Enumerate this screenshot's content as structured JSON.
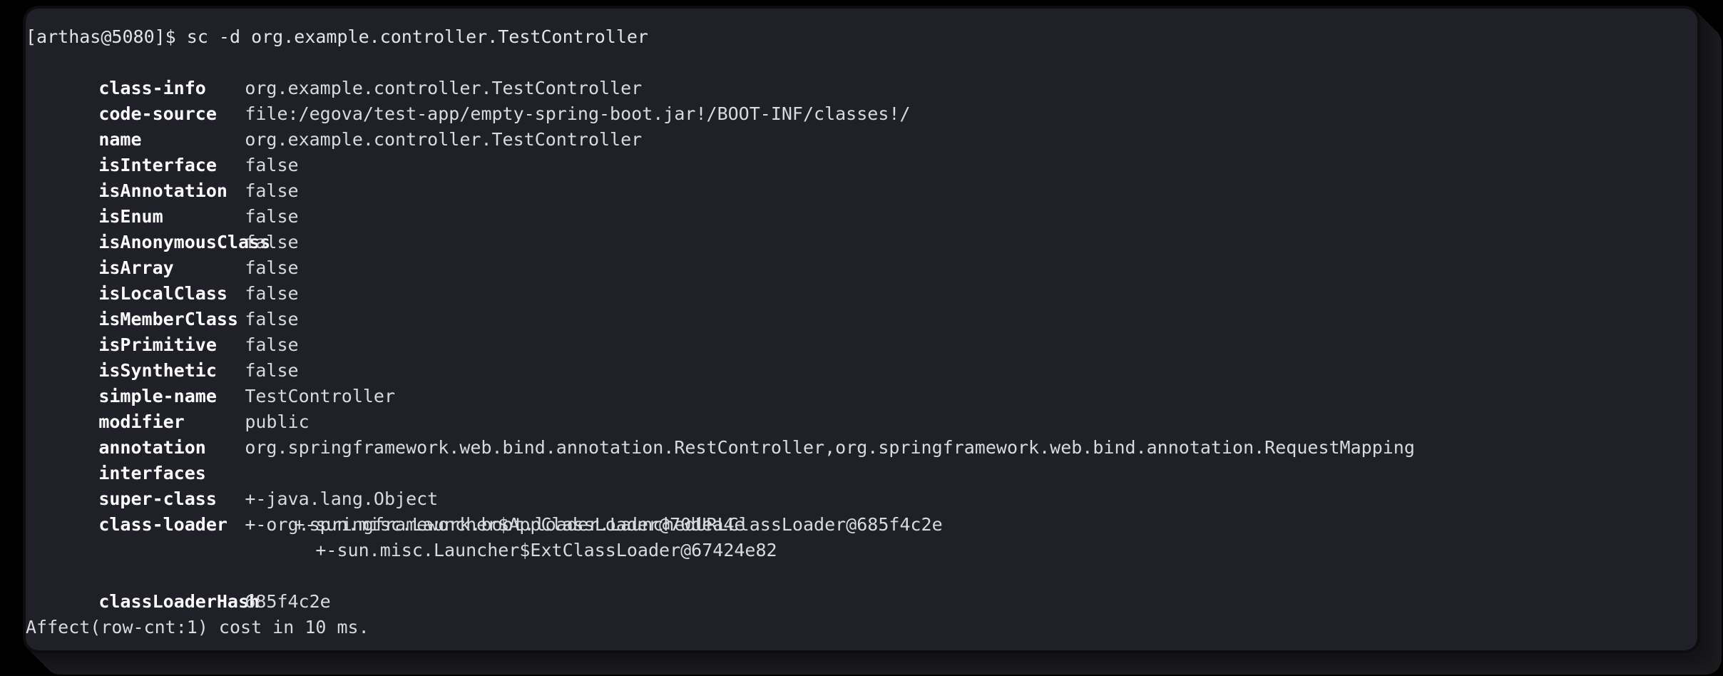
{
  "terminal": {
    "prompt": "[arthas@5080]$ sc -d org.example.controller.TestController",
    "rows": [
      {
        "key": "class-info",
        "value": "org.example.controller.TestController"
      },
      {
        "key": "code-source",
        "value": "file:/egova/test-app/empty-spring-boot.jar!/BOOT-INF/classes!/"
      },
      {
        "key": "name",
        "value": "org.example.controller.TestController"
      },
      {
        "key": "isInterface",
        "value": "false"
      },
      {
        "key": "isAnnotation",
        "value": "false"
      },
      {
        "key": "isEnum",
        "value": "false"
      },
      {
        "key": "isAnonymousClass",
        "value": "false"
      },
      {
        "key": "isArray",
        "value": "false"
      },
      {
        "key": "isLocalClass",
        "value": "false"
      },
      {
        "key": "isMemberClass",
        "value": "false"
      },
      {
        "key": "isPrimitive",
        "value": "false"
      },
      {
        "key": "isSynthetic",
        "value": "false"
      },
      {
        "key": "simple-name",
        "value": "TestController"
      },
      {
        "key": "modifier",
        "value": "public"
      },
      {
        "key": "annotation",
        "value": "org.springframework.web.bind.annotation.RestController,org.springframework.web.bind.annotation.RequestMapping"
      },
      {
        "key": "interfaces",
        "value": ""
      },
      {
        "key": "super-class",
        "value": "+-java.lang.Object"
      },
      {
        "key": "class-loader",
        "value": "+-org.springframework.boot.loader.LaunchedURLClassLoader@685f4c2e"
      }
    ],
    "class_loader_tree": [
      "                         +-sun.misc.Launcher$AppClassLoader@70dea4e",
      "                           +-sun.misc.Launcher$ExtClassLoader@67424e82"
    ],
    "class_loader_hash": {
      "key": "classLoaderHash",
      "value": "685f4c2e"
    },
    "footer": "Affect(row-cnt:1) cost in 10 ms."
  },
  "colors": {
    "background": "#000000",
    "terminal_background": "#1f2028",
    "text": "#e3e4e8",
    "key_text": "#ffffff",
    "value_text": "#d9dae0"
  }
}
